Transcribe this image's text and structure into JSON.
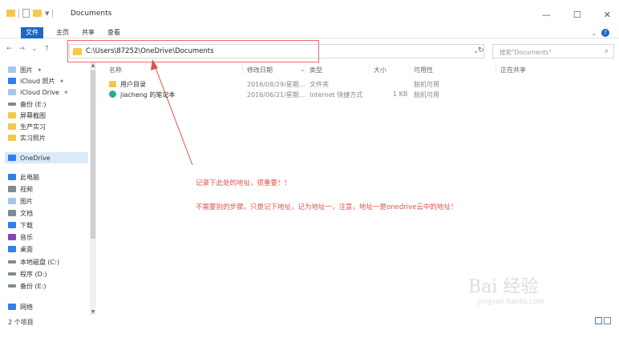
{
  "window": {
    "title": "Documents",
    "controls": [
      "—",
      "☐",
      "✕"
    ]
  },
  "ribbon": {
    "tabs": [
      "文件",
      "主页",
      "共享",
      "查看"
    ]
  },
  "address": {
    "path": "C:\\Users\\87252\\OneDrive\\Documents",
    "search_placeholder": "搜索\"Documents\""
  },
  "nav_pane": {
    "items": [
      {
        "label": "图片",
        "icon": "picture-icon",
        "pinned": true
      },
      {
        "label": "iCloud 照片",
        "icon": "icloud-photos-icon",
        "pinned": true
      },
      {
        "label": "iCloud Drive",
        "icon": "icloud-drive-icon",
        "pinned": true
      },
      {
        "label": "备份 (E:)",
        "icon": "drive-icon",
        "pinned": false
      },
      {
        "label": "屏幕截图",
        "icon": "folder-icon",
        "pinned": false
      },
      {
        "label": "生产实习",
        "icon": "folder-icon",
        "pinned": false
      },
      {
        "label": "实习照片",
        "icon": "folder-icon",
        "pinned": false
      },
      {
        "label": "OneDrive",
        "icon": "onedrive-icon",
        "pinned": false
      },
      {
        "label": "此电脑",
        "icon": "computer-icon",
        "pinned": false
      },
      {
        "label": "视频",
        "icon": "video-icon",
        "pinned": false
      },
      {
        "label": "图片",
        "icon": "picture-icon",
        "pinned": false
      },
      {
        "label": "文档",
        "icon": "document-icon",
        "pinned": false
      },
      {
        "label": "下载",
        "icon": "download-icon",
        "pinned": false
      },
      {
        "label": "音乐",
        "icon": "music-icon",
        "pinned": false
      },
      {
        "label": "桌面",
        "icon": "desktop-icon",
        "pinned": false
      },
      {
        "label": "本地磁盘 (C:)",
        "icon": "drive-icon",
        "pinned": false
      },
      {
        "label": "程序 (D:)",
        "icon": "drive-icon",
        "pinned": false
      },
      {
        "label": "备份 (E:)",
        "icon": "drive-icon",
        "pinned": false
      },
      {
        "label": "网络",
        "icon": "network-icon",
        "pinned": false
      }
    ]
  },
  "columns": [
    "名称",
    "修改日期",
    "类型",
    "大小",
    "可用性",
    "正在共享"
  ],
  "files": [
    {
      "name": "用户目录",
      "date": "2016/08/29/星期...",
      "type": "文件夹",
      "size": "",
      "availability": "脱机可用",
      "icon": "folder-icon"
    },
    {
      "name": "jiacheng 的笔记本",
      "date": "2016/06/21/星期...",
      "type": "Internet 快捷方式",
      "size": "1 KB",
      "availability": "脱机可用",
      "icon": "onenote-icon"
    }
  ],
  "annotations": {
    "line1": "记录下此处的地址，很重要！！",
    "line2": "不需要别的步骤，只是记下地址，记为地址一，注意，地址一是onedrive云中的地址！"
  },
  "status": {
    "count": "2 个项目"
  },
  "watermark": {
    "brand": "Bai 经验",
    "site": "jingyan.baidu.com"
  },
  "colors": {
    "accent": "#1a68c7",
    "annotation": "#e0524a"
  }
}
